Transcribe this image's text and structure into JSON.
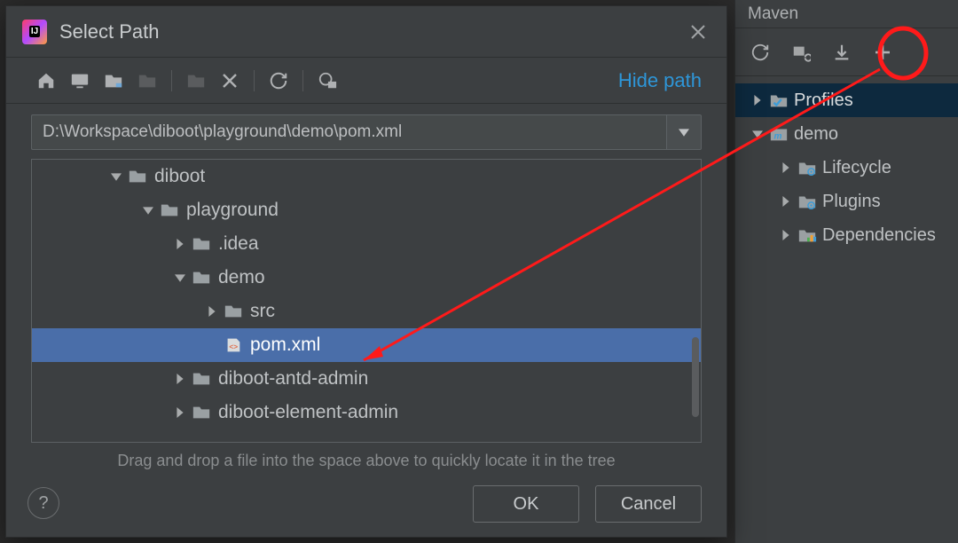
{
  "maven": {
    "title": "Maven",
    "profiles_label": "Profiles",
    "module_label": "demo",
    "lifecycle_label": "Lifecycle",
    "plugins_label": "Plugins",
    "dependencies_label": "Dependencies"
  },
  "dialog": {
    "title": "Select Path",
    "hide_path": "Hide path",
    "path": "D:\\Workspace\\diboot\\playground\\demo\\pom.xml",
    "hint": "Drag and drop a file into the space above to quickly locate it in the tree",
    "ok": "OK",
    "cancel": "Cancel"
  },
  "tree": {
    "n0": "diboot",
    "n1": "playground",
    "n2": ".idea",
    "n3": "demo",
    "n4": "src",
    "n5": "pom.xml",
    "n6": "diboot-antd-admin",
    "n7": "diboot-element-admin"
  }
}
